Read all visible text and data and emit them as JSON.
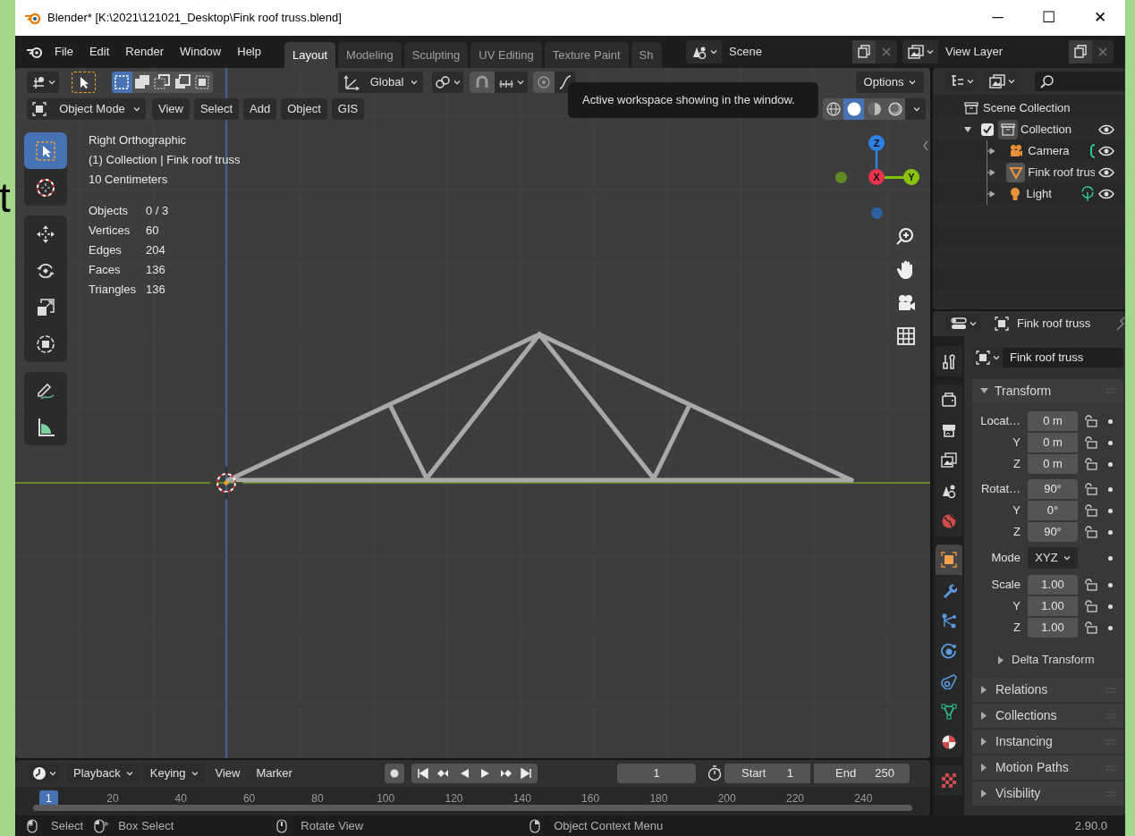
{
  "window": {
    "title": "Blender* [K:\\2021\\121021_Desktop\\Fink roof truss.blend]",
    "controls": [
      "─",
      "☐",
      "✕"
    ]
  },
  "background_fragment": "t",
  "menu": [
    "File",
    "Edit",
    "Render",
    "Window",
    "Help"
  ],
  "workspace_tabs": [
    {
      "label": "Layout",
      "selected": true
    },
    {
      "label": "Modeling",
      "selected": false
    },
    {
      "label": "Sculpting",
      "selected": false
    },
    {
      "label": "UV Editing",
      "selected": false
    },
    {
      "label": "Texture Paint",
      "selected": false
    },
    {
      "label": "Sh",
      "selected": false
    }
  ],
  "scene": {
    "value": "Scene"
  },
  "view_layer": {
    "value": "View Layer"
  },
  "tooltip": "Active workspace showing in the window.",
  "viewport": {
    "select_modes": [
      {
        "selected": true
      },
      {
        "selected": false
      },
      {
        "selected": false
      },
      {
        "selected": false
      },
      {
        "selected": false
      }
    ],
    "transform_orientation": "Global",
    "options": "Options",
    "mode": "Object Mode",
    "menus": [
      "View",
      "Select",
      "Add",
      "Object",
      "GIS"
    ],
    "shading_modes": [
      {
        "selected": false
      },
      {
        "selected": true
      },
      {
        "selected": false
      },
      {
        "selected": false
      }
    ],
    "tool_groups": [
      [
        {
          "kind": "select",
          "selected": true
        },
        {
          "kind": "cursor",
          "selected": false
        }
      ],
      [
        {
          "kind": "move",
          "selected": false
        },
        {
          "kind": "rotate",
          "selected": false
        },
        {
          "kind": "scale",
          "selected": false
        },
        {
          "kind": "transform",
          "selected": false
        }
      ],
      [
        {
          "kind": "annotate",
          "selected": false
        },
        {
          "kind": "measure",
          "selected": false
        }
      ]
    ],
    "info": [
      "Right Orthographic",
      "(1) Collection | Fink roof truss",
      "10 Centimeters"
    ],
    "stats": [
      {
        "label": "Objects",
        "value": "0 / 3"
      },
      {
        "label": "Vertices",
        "value": "60"
      },
      {
        "label": "Edges",
        "value": "204"
      },
      {
        "label": "Faces",
        "value": "136"
      },
      {
        "label": "Triangles",
        "value": "136"
      }
    ],
    "gizmo": [
      {
        "kind": "up",
        "label": "Z",
        "color": "#2f7fe4"
      },
      {
        "kind": "front",
        "label": "X",
        "color": "#e8344c"
      },
      {
        "kind": "right",
        "label": "Y",
        "color": "#86c20e"
      },
      {
        "kind": "left",
        "color": "#5f8a22"
      },
      {
        "kind": "down",
        "color": "#2c5f9e"
      }
    ]
  },
  "timeline": {
    "menus": [
      {
        "kind": "dropdown",
        "label": "Playback"
      },
      {
        "kind": "dropdown",
        "label": "Keying"
      },
      {
        "kind": "menu",
        "label": "View"
      },
      {
        "kind": "menu",
        "label": "Marker"
      }
    ],
    "current_frame": "1",
    "start": {
      "label": "Start",
      "value": "1"
    },
    "end": {
      "label": "End",
      "value": "250"
    },
    "ruler_current": "1",
    "ruler_ticks": [
      "20",
      "40",
      "60",
      "80",
      "100",
      "120",
      "140",
      "160",
      "180",
      "200",
      "220",
      "240"
    ]
  },
  "outliner": {
    "root": "Scene Collection",
    "tree": [
      {
        "label": "Collection",
        "kind": "collection",
        "checked": true,
        "expanded": true,
        "visible": true,
        "selected": false,
        "children": [
          {
            "label": "Camera",
            "kind": "camera",
            "visible": true,
            "selected": false
          },
          {
            "label": "Fink roof trus",
            "kind": "mesh",
            "visible": true,
            "selected": true
          },
          {
            "label": "Light",
            "kind": "light",
            "visible": true,
            "selected": false
          }
        ]
      }
    ]
  },
  "properties": {
    "header": "Fink roof truss",
    "object_name": "Fink roof truss",
    "tab_groups": [
      [
        {
          "kind": "tool",
          "selected": false
        }
      ],
      [
        {
          "kind": "render",
          "selected": false
        },
        {
          "kind": "output",
          "selected": false
        },
        {
          "kind": "viewlayer",
          "selected": false
        },
        {
          "kind": "scene",
          "selected": false
        },
        {
          "kind": "world",
          "selected": false
        }
      ],
      [
        {
          "kind": "object",
          "selected": true
        },
        {
          "kind": "modifiers",
          "selected": false
        },
        {
          "kind": "particles",
          "selected": false
        },
        {
          "kind": "physics",
          "selected": false
        },
        {
          "kind": "constraints",
          "selected": false
        },
        {
          "kind": "data",
          "selected": false
        },
        {
          "kind": "material",
          "selected": false
        }
      ],
      [
        {
          "kind": "texture",
          "selected": false
        }
      ]
    ],
    "transform": {
      "title": "Transform",
      "expanded": true,
      "rows": [
        {
          "kind": "vector",
          "label": "Locat…",
          "fields": [
            {
              "value": "0 m"
            },
            {
              "axis": "Y",
              "value": "0 m"
            },
            {
              "axis": "Z",
              "value": "0 m"
            }
          ]
        },
        {
          "kind": "vector",
          "label": "Rotat…",
          "fields": [
            {
              "value": "90°"
            },
            {
              "axis": "Y",
              "value": "0°"
            },
            {
              "axis": "Z",
              "value": "90°"
            }
          ]
        },
        {
          "kind": "select",
          "label": "Mode",
          "value": "XYZ"
        },
        {
          "kind": "vector",
          "label": "Scale",
          "fields": [
            {
              "value": "1.00"
            },
            {
              "axis": "Y",
              "value": "1.00"
            },
            {
              "axis": "Z",
              "value": "1.00"
            }
          ]
        }
      ],
      "subpanel": {
        "title": "Delta Transform",
        "expanded": false
      }
    },
    "panels": [
      {
        "title": "Relations",
        "expanded": false
      },
      {
        "title": "Collections",
        "expanded": false
      },
      {
        "title": "Instancing",
        "expanded": false
      },
      {
        "title": "Motion Paths",
        "expanded": false
      },
      {
        "title": "Visibility",
        "expanded": false
      }
    ]
  },
  "status_bar": {
    "hints": [
      {
        "kind": "left",
        "label": "Select"
      },
      {
        "kind": "leftdrag",
        "label": "Box Select"
      },
      {
        "kind": "middle",
        "label": "Rotate View"
      },
      {
        "kind": "right",
        "label": "Object Context Menu"
      }
    ],
    "version": "2.90.0"
  }
}
